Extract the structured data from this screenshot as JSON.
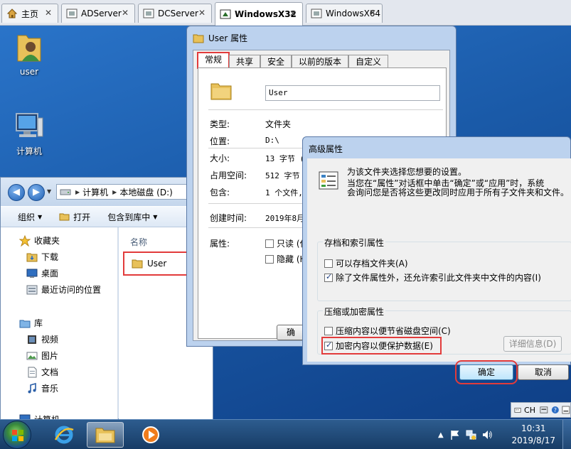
{
  "tabs": [
    {
      "label": "主页",
      "icon": "home-icon"
    },
    {
      "label": "ADServer",
      "icon": "vm-icon"
    },
    {
      "label": "DCServer",
      "icon": "vm-icon"
    },
    {
      "label": "WindowsX32",
      "icon": "vm-icon"
    },
    {
      "label": "WindowsX64",
      "icon": "vm-icon"
    }
  ],
  "tab_close": "✕",
  "desktop": {
    "icons": [
      {
        "label": "user",
        "icon": "user-folder-icon"
      },
      {
        "label": "计算机",
        "icon": "computer-icon"
      }
    ]
  },
  "explorer": {
    "address": [
      "计算机",
      "本地磁盘 (D:)"
    ],
    "commands": [
      "组织",
      "打开",
      "包含到库中"
    ],
    "sidebar": {
      "favorites_title": "收藏夹",
      "favorites": [
        "下载",
        "桌面",
        "最近访问的位置"
      ],
      "libraries_title": "库",
      "libraries": [
        "视频",
        "图片",
        "文档",
        "音乐"
      ],
      "computer_title": "计算机"
    },
    "column_name": "名称",
    "file": "User"
  },
  "properties": {
    "title": "User 属性",
    "tabs": [
      "常规",
      "共享",
      "安全",
      "以前的版本",
      "自定义"
    ],
    "name_value": "User",
    "rows": [
      {
        "label": "类型:",
        "value": "文件夹"
      },
      {
        "label": "位置:",
        "value": "D:\\"
      },
      {
        "label": "大小:",
        "value": "13 字节 ("
      },
      {
        "label": "占用空间:",
        "value": "512 字节 ("
      },
      {
        "label": "包含:",
        "value": "1 个文件,"
      },
      {
        "label": "创建时间:",
        "value": "2019年8月1"
      },
      {
        "label": "属性:",
        "value": ""
      }
    ],
    "attr_readonly": "只读 (仅",
    "attr_hidden": "隐藏 (H)",
    "ok_partial": "确"
  },
  "advanced": {
    "title": "高级属性",
    "desc1": "为该文件夹选择您想要的设置。",
    "desc2": "当您在“属性”对话框中单击“确定”或“应用”时，系统",
    "desc3": "会询问您是否将这些更改同时应用于所有子文件夹和文件。",
    "group1_label": "存档和索引属性",
    "archive_label": "可以存档文件夹(A)",
    "archive_checked": false,
    "index_label": "除了文件属性外，还允许索引此文件夹中文件的内容(I)",
    "index_checked": true,
    "group2_label": "压缩或加密属性",
    "compress_label": "压缩内容以便节省磁盘空间(C)",
    "compress_checked": false,
    "encrypt_label": "加密内容以便保护数据(E)",
    "encrypt_checked": true,
    "details_button": "详细信息(D)",
    "ok_button": "确定",
    "cancel_button": "取消"
  },
  "taskbar": {
    "lang": "CH",
    "time": "10:31",
    "date": "2019/8/17"
  }
}
